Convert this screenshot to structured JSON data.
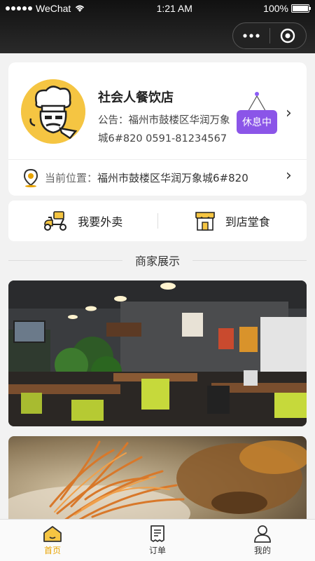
{
  "status_bar": {
    "carrier": "WeChat",
    "time": "1:21 AM",
    "battery": "100%",
    "battery_level": 1.0
  },
  "nav": {
    "more_icon": "more-dots-icon",
    "close_icon": "target-icon"
  },
  "shop": {
    "name": "社会人餐饮店",
    "notice": "公告：福州市鼓楼区华润万象城6#820  0591-81234567",
    "status": "休息中",
    "location_label": "当前位置：",
    "location_value": "福州市鼓楼区华润万象城6#820"
  },
  "order_modes": {
    "delivery_label": "我要外卖",
    "dine_in_label": "到店堂食"
  },
  "section": {
    "title": "商家展示"
  },
  "tabs": [
    {
      "label": "首页",
      "icon": "home-icon",
      "active": true
    },
    {
      "label": "订单",
      "icon": "order-icon",
      "active": false
    },
    {
      "label": "我的",
      "icon": "user-icon",
      "active": false
    }
  ],
  "colors": {
    "accent": "#e8a300",
    "status_tag": "#8b55e8",
    "nav_bg": "#1e1e1e"
  }
}
